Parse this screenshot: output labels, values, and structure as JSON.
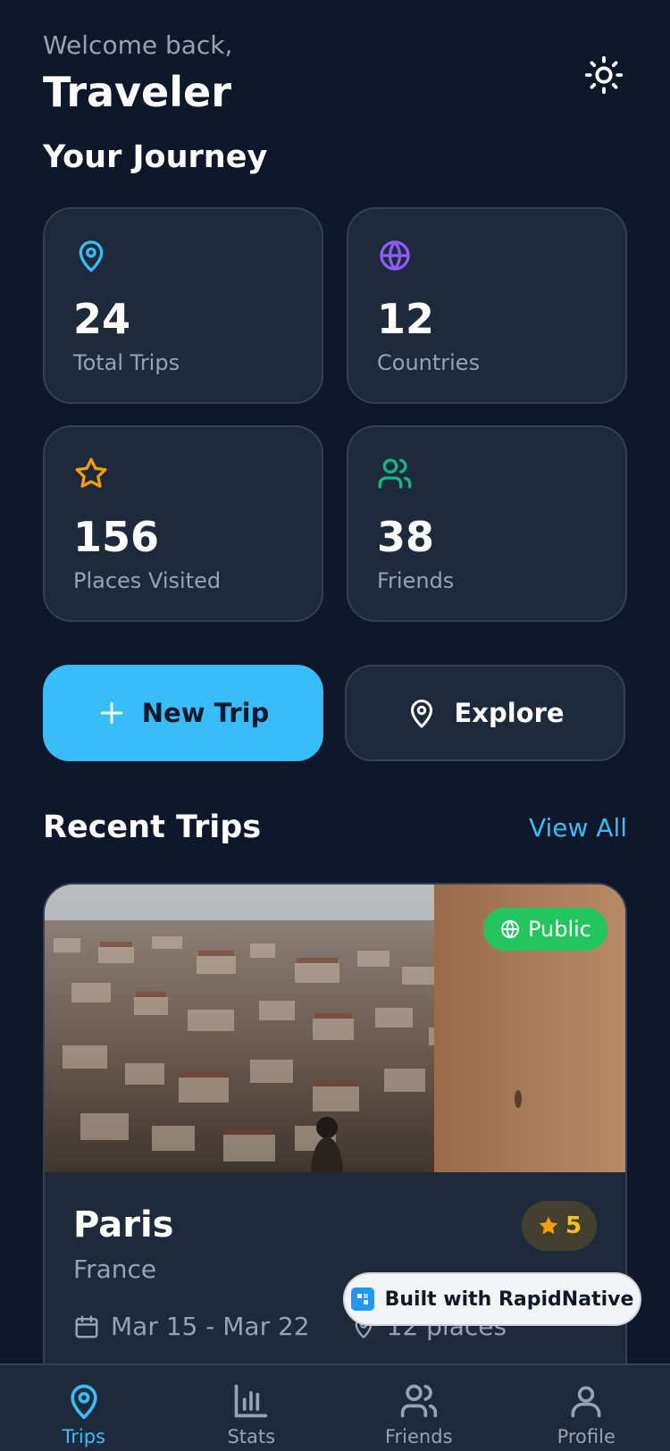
{
  "header": {
    "greeting": "Welcome back,",
    "username": "Traveler",
    "theme_toggle_icon": "sun-icon"
  },
  "journey": {
    "title": "Your Journey",
    "stats": [
      {
        "value": "24",
        "label": "Total Trips",
        "icon": "map-pin-icon",
        "color": "#38bdf8"
      },
      {
        "value": "12",
        "label": "Countries",
        "icon": "globe-icon",
        "color": "#8b5cf6"
      },
      {
        "value": "156",
        "label": "Places Visited",
        "icon": "star-icon",
        "color": "#f59e0b"
      },
      {
        "value": "38",
        "label": "Friends",
        "icon": "users-icon",
        "color": "#10b981"
      }
    ]
  },
  "actions": {
    "new_trip": "New Trip",
    "explore": "Explore"
  },
  "recent": {
    "title": "Recent Trips",
    "view_all": "View All",
    "trips": [
      {
        "name": "Paris",
        "country": "France",
        "visibility": "Public",
        "rating": "5",
        "dates": "Mar 15 - Mar 22",
        "places": "12 places"
      }
    ]
  },
  "overlay": {
    "built_with": "Built with RapidNative"
  },
  "tabbar": {
    "tabs": [
      {
        "label": "Trips",
        "icon": "map-pin-icon",
        "active": true
      },
      {
        "label": "Stats",
        "icon": "bar-chart-icon",
        "active": false
      },
      {
        "label": "Friends",
        "icon": "users-icon",
        "active": false
      },
      {
        "label": "Profile",
        "icon": "user-icon",
        "active": false
      }
    ]
  },
  "colors": {
    "background": "#0f172a",
    "card": "#1e293b",
    "accent": "#38bdf8",
    "public_badge": "#22c55e",
    "rating": "#fbbf24"
  }
}
